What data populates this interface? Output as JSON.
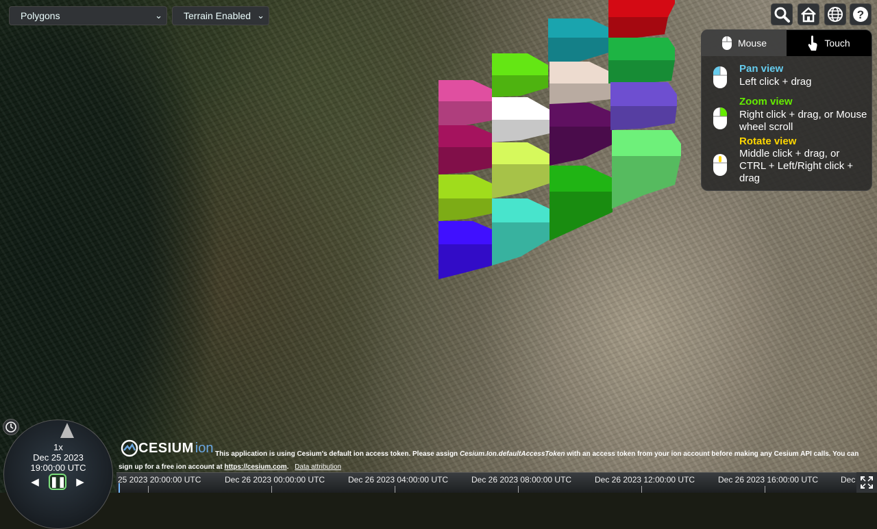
{
  "toolbar": {
    "scenario_select": "Polygons",
    "terrain_select": "Terrain Enabled"
  },
  "tools": {
    "search_icon": "search-icon",
    "home_icon": "home-icon",
    "globe_icon": "globe-icon",
    "help_icon": "help-icon"
  },
  "nav_help": {
    "tab_mouse": "Mouse",
    "tab_touch": "Touch",
    "pan_title": "Pan view",
    "pan_desc": "Left click + drag",
    "zoom_title": "Zoom view",
    "zoom_desc": "Right click + drag, or Mouse wheel scroll",
    "rotate_title": "Rotate view",
    "rotate_desc": "Middle click + drag, or CTRL + Left/Right click + drag",
    "colors": {
      "pan": "#66ccee",
      "zoom": "#65ec00",
      "rotate": "#ffd700"
    }
  },
  "credits": {
    "logo_text": "CESIUM",
    "logo_ion": "ion",
    "token_prefix": "This application is using Cesium's default ion access token. Please assign ",
    "token_code": "Cesium.Ion.defaultAccessToken",
    "token_suffix": " with an access token from your ion account before making any Cesium API calls. You can",
    "signup_prefix": "sign up for a free ion account at ",
    "signup_link": "https://cesium.com",
    "signup_suffix": ".",
    "data_attribution": "Data attribution"
  },
  "animation": {
    "speed": "1x",
    "date": "Dec 25 2023",
    "time": "19:00:00 UTC"
  },
  "timeline": {
    "labels": [
      "25 2023 20:00:00 UTC",
      "Dec 26 2023 00:00:00 UTC",
      "Dec 26 2023 04:00:00 UTC",
      "Dec 26 2023 08:00:00 UTC",
      "Dec 26 2023 12:00:00 UTC",
      "Dec 26 2023 16:00:00 UTC",
      "Dec"
    ]
  },
  "polygons": {
    "colors": [
      "#e04fa0",
      "#64e614",
      "#ffffff",
      "#5f1060",
      "#a0dc1c",
      "#d6f95c",
      "#4010ff",
      "#48e4cc",
      "#20b414",
      "#1aa4ae",
      "#eddbcf",
      "#a5135e",
      "#d40a14",
      "#1eb444",
      "#6e4fd0",
      "#6ef07a"
    ]
  }
}
